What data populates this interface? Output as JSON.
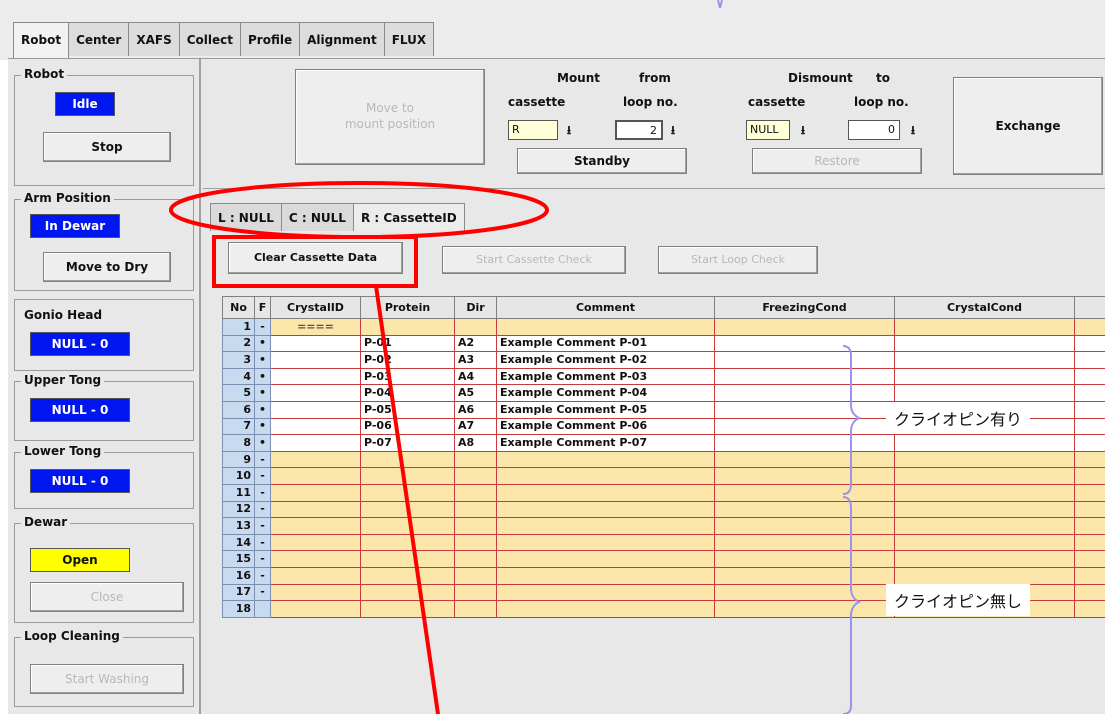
{
  "main_tabs": [
    "Robot",
    "Center",
    "XAFS",
    "Collect",
    "Profile",
    "Alignment",
    "FLUX"
  ],
  "robot_group": {
    "title": "Robot",
    "status": "Idle",
    "stop_label": "Stop"
  },
  "arm_group": {
    "title": "Arm Position",
    "status": "In Dewar",
    "move_label": "Move to Dry"
  },
  "gonio_group": {
    "title": "Gonio Head",
    "value": "NULL - 0"
  },
  "upper_group": {
    "title": "Upper Tong",
    "value": "NULL - 0"
  },
  "lower_group": {
    "title": "Lower Tong",
    "value": "NULL - 0"
  },
  "dewar_group": {
    "title": "Dewar",
    "status": "Open",
    "close_label": "Close"
  },
  "loop_group": {
    "title": "Loop Cleaning",
    "wash_label": "Start Washing"
  },
  "controls": {
    "move_to_mount_line1": "Move to",
    "move_to_mount_line2": "mount position",
    "mount_label": "Mount",
    "from_label": "from",
    "cassette_label": "cassette",
    "loop_label": "loop no.",
    "mount_cassette_value": "R",
    "mount_loop_value": "2",
    "dismount_label": "Dismount",
    "to_label": "to",
    "dismount_cassette_value": "NULL",
    "dismount_loop_value": "0",
    "standby_label": "Standby",
    "restore_label": "Restore",
    "exchange_label": "Exchange",
    "arrow_glyph": "⭳"
  },
  "sub_tabs": [
    "L : NULL",
    "C : NULL",
    "R : CassetteID"
  ],
  "actions": {
    "clear_label": "Clear Cassette Data",
    "cassette_check_label": "Start Cassette Check",
    "loop_check_label": "Start Loop Check"
  },
  "table": {
    "headers": [
      "No",
      "F",
      "CrystalID",
      "Protein",
      "Dir",
      "Comment",
      "FreezingCond",
      "CrystalCond",
      ""
    ],
    "rows": [
      [
        "1",
        "-",
        "====",
        "",
        "",
        "",
        "",
        "",
        ""
      ],
      [
        "2",
        "•",
        "",
        "P-01",
        "A2",
        "Example Comment P-01",
        "",
        "",
        ""
      ],
      [
        "3",
        "•",
        "",
        "P-02",
        "A3",
        "Example Comment P-02",
        "",
        "",
        ""
      ],
      [
        "4",
        "•",
        "",
        "P-03",
        "A4",
        "Example Comment P-03",
        "",
        "",
        ""
      ],
      [
        "5",
        "•",
        "",
        "P-04",
        "A5",
        "Example Comment P-04",
        "",
        "",
        ""
      ],
      [
        "6",
        "•",
        "",
        "P-05",
        "A6",
        "Example Comment P-05",
        "",
        "",
        ""
      ],
      [
        "7",
        "•",
        "",
        "P-06",
        "A7",
        "Example Comment P-06",
        "",
        "",
        ""
      ],
      [
        "8",
        "•",
        "",
        "P-07",
        "A8",
        "Example Comment P-07",
        "",
        "",
        ""
      ],
      [
        "9",
        "-",
        "",
        "",
        "",
        "",
        "",
        "",
        ""
      ],
      [
        "10",
        "-",
        "",
        "",
        "",
        "",
        "",
        "",
        ""
      ],
      [
        "11",
        "-",
        "",
        "",
        "",
        "",
        "",
        "",
        ""
      ],
      [
        "12",
        "-",
        "",
        "",
        "",
        "",
        "",
        "",
        ""
      ],
      [
        "13",
        "-",
        "",
        "",
        "",
        "",
        "",
        "",
        ""
      ],
      [
        "14",
        "-",
        "",
        "",
        "",
        "",
        "",
        "",
        ""
      ],
      [
        "15",
        "-",
        "",
        "",
        "",
        "",
        "",
        "",
        ""
      ],
      [
        "16",
        "-",
        "",
        "",
        "",
        "",
        "",
        "",
        ""
      ],
      [
        "17",
        "-",
        "",
        "",
        "",
        "",
        "",
        "",
        ""
      ],
      [
        "18",
        "",
        "",
        "",
        "",
        "",
        "",
        "",
        ""
      ]
    ]
  },
  "annotations": {
    "with_pin": "クライオピン有り",
    "without_pin": "クライオピン無し"
  },
  "colors": {
    "indicator_blue": "#0016f0",
    "indicator_yellow": "#ffff00",
    "empty_row": "#fae6a8",
    "highlight_red": "#ff0000",
    "brace": "#9b93ee"
  }
}
